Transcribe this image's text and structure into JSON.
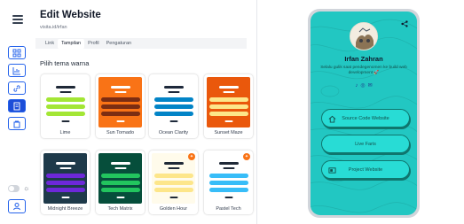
{
  "editor": {
    "title": "Edit Website",
    "url": "visita.id/irfan",
    "tabs": [
      "Link",
      "Tampilan",
      "Profil",
      "Pengaturan"
    ],
    "active_tab": "Tampilan",
    "section_label": "Pilih tema warna"
  },
  "themes": [
    {
      "name": "Lime",
      "badge": false,
      "colors": {
        "bg": "#ffffff",
        "line": "#1f2937",
        "btn": "#a3e635",
        "foot": "#1f2937"
      }
    },
    {
      "name": "Sun Tornado",
      "badge": false,
      "colors": {
        "bg": "#f97316",
        "line": "#ffffff",
        "btn": "#7c2d12",
        "foot": "#ffffff"
      }
    },
    {
      "name": "Ocean Clarity",
      "badge": false,
      "colors": {
        "bg": "#ffffff",
        "line": "#1e293b",
        "btn": "#0284c7",
        "foot": "#1e293b"
      }
    },
    {
      "name": "Sunset Maze",
      "badge": false,
      "colors": {
        "bg": "#ea580c",
        "line": "#ffffff",
        "btn": "#fde68a",
        "foot": "#ffffff"
      }
    },
    {
      "name": "Midnight Breeze",
      "badge": false,
      "colors": {
        "bg": "#1e3a4a",
        "line": "#ffffff",
        "btn": "#6d28d9",
        "foot": "#ffffff"
      }
    },
    {
      "name": "Tech Matrix",
      "badge": false,
      "colors": {
        "bg": "#064e3b",
        "line": "#ffffff",
        "btn": "#22c55e",
        "foot": "#ffffff"
      }
    },
    {
      "name": "Golden Hour",
      "badge": true,
      "colors": {
        "bg": "#fffbeb",
        "line": "#1f2937",
        "btn": "#fde68a",
        "foot": "#1f2937"
      }
    },
    {
      "name": "Pastel Tech",
      "badge": true,
      "colors": {
        "bg": "#ffffff",
        "line": "#1f2937",
        "btn": "#38bdf8",
        "foot": "#1f2937"
      }
    }
  ],
  "preview": {
    "name": "Irfan Zahran",
    "bio": "Selalu gulik saat pendegenomen ke build web development 🚀",
    "socials": [
      "♪",
      "◎",
      "✉"
    ],
    "links": [
      "Source Code Website",
      "Live Faris",
      "Project Website"
    ],
    "accent": "#22c7c2"
  },
  "icons": {
    "menu": "hamburger-icon",
    "dashboard": "grid-icon",
    "analytics": "chart-icon",
    "links": "link-icon",
    "appearance": "palette-icon",
    "shop": "bag-icon",
    "theme": "sun-icon",
    "account": "user-icon",
    "share": "share-icon"
  }
}
